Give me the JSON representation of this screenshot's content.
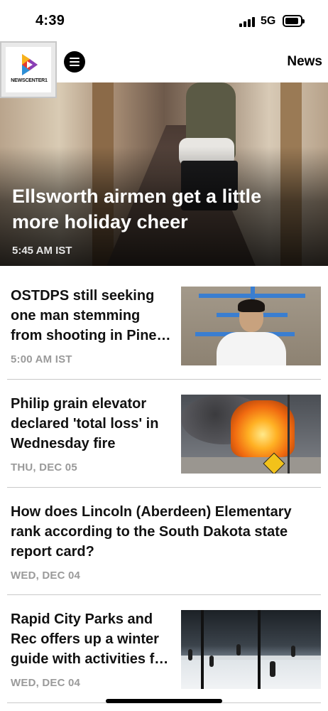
{
  "status_bar": {
    "time": "4:39",
    "network": "5G"
  },
  "header": {
    "logo_text": "NEWSCENTER1",
    "title": "News"
  },
  "hero": {
    "title": "Ellsworth airmen get a little more holiday cheer",
    "time": "5:45 AM IST"
  },
  "articles": [
    {
      "title": "OSTDPS still seeking one man stemming from shooting in Pine…",
      "date": "5:00 AM IST",
      "has_thumbnail": true
    },
    {
      "title": "Philip grain elevator declared 'total loss' in Wednesday fire",
      "date": "THU, DEC 05",
      "has_thumbnail": true
    },
    {
      "title": "How does Lincoln (Aberdeen) Elementary rank according to the South Dakota state report card?",
      "date": "WED, DEC 04",
      "has_thumbnail": false
    },
    {
      "title": "Rapid City Parks and Rec offers up a winter guide with activities f…",
      "date": "WED, DEC 04",
      "has_thumbnail": true
    }
  ],
  "colors": {
    "accent_blue": "#3a7ed0",
    "date_gray": "#9a9a9a",
    "divider": "#c9c9c9"
  },
  "icons": {
    "menu": "hamburger-menu-icon",
    "signal": "cellular-signal-icon",
    "battery": "battery-icon"
  }
}
